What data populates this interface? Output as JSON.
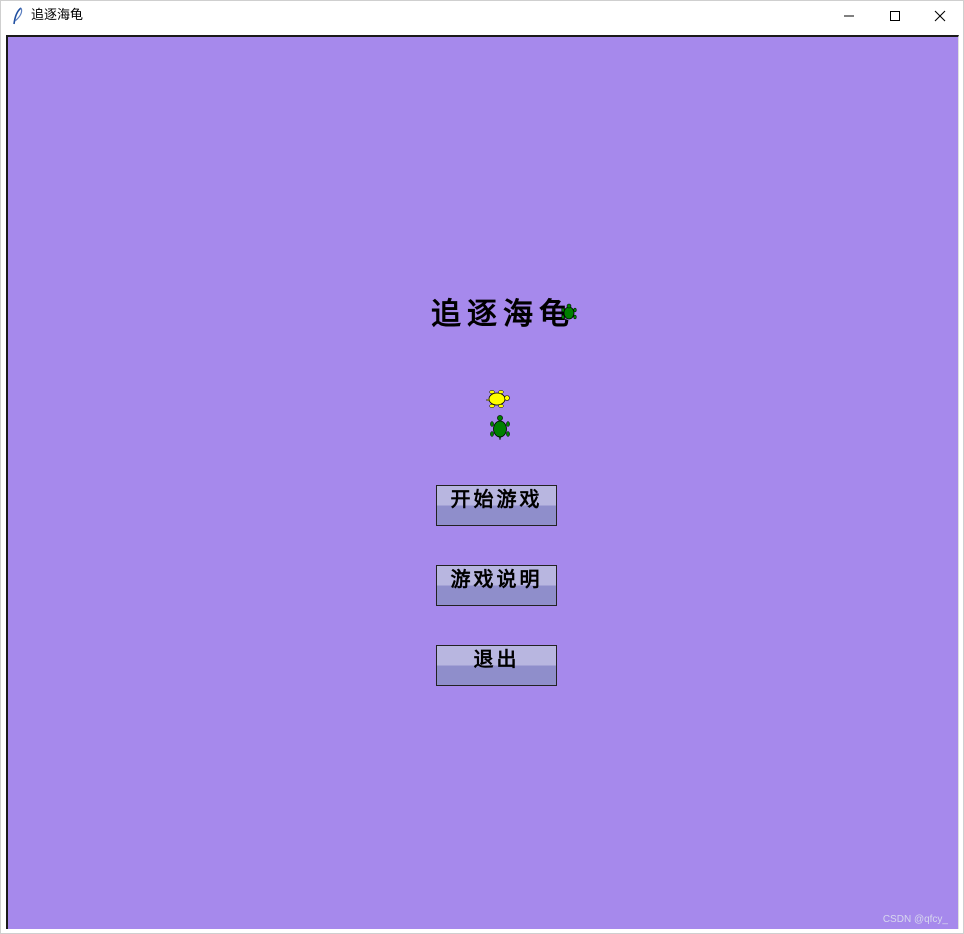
{
  "window": {
    "title": "追逐海龟",
    "icon": "feather-icon"
  },
  "canvas": {
    "background": "#a689ec"
  },
  "game": {
    "title": "追逐海龟"
  },
  "turtles": [
    {
      "name": "title-turtle",
      "color": "#008000"
    },
    {
      "name": "player-turtle",
      "color": "#ffff00"
    },
    {
      "name": "chaser-turtle",
      "color": "#008000"
    }
  ],
  "menu": {
    "start_label": "开始游戏",
    "help_label": "游戏说明",
    "quit_label": "退出"
  },
  "watermark": "CSDN @qfcy_"
}
